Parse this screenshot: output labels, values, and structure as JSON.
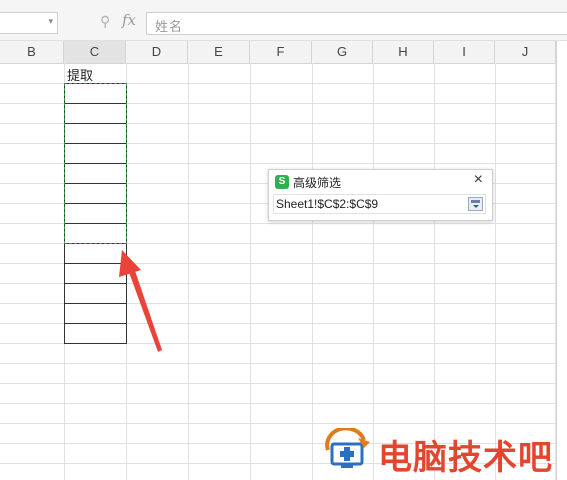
{
  "formula_bar": {
    "fx_label": "fx",
    "formula_value": "姓名"
  },
  "columns": [
    "B",
    "C",
    "D",
    "E",
    "F",
    "G",
    "H",
    "I",
    "J"
  ],
  "sheet": {
    "c1_text": "提取"
  },
  "dialog": {
    "title": "高级筛选",
    "app_icon_letter": "S",
    "close_glyph": "×",
    "range_value": "Sheet1!$C$2:$C$9"
  },
  "watermark": {
    "text": "电脑技术吧"
  },
  "colors": {
    "marquee": "#2e9b3c",
    "arrow": "#e8443a",
    "watermark": "#e2462f",
    "app_icon": "#2fb04f"
  }
}
